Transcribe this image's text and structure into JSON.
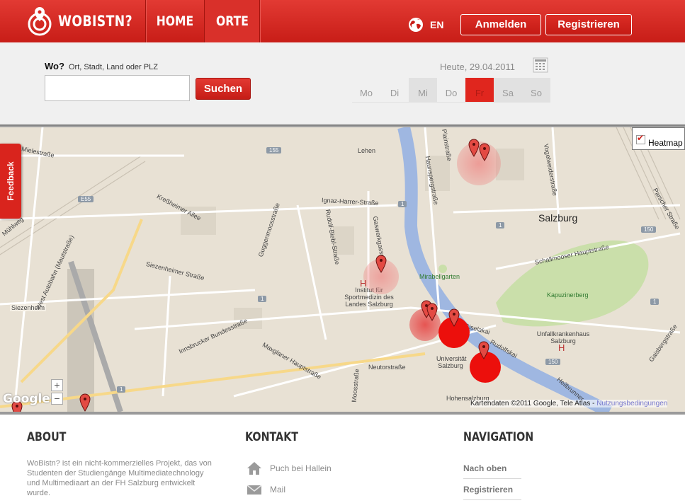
{
  "header": {
    "brand": "WOBISTN?",
    "nav": [
      {
        "label": "HOME"
      },
      {
        "label": "ORTE",
        "active": true
      }
    ],
    "language": "EN",
    "login_label": "Anmelden",
    "register_label": "Registrieren"
  },
  "search": {
    "wo_label": "Wo?",
    "hint": "Ort, Stadt, Land oder PLZ",
    "input_value": "",
    "button_label": "Suchen",
    "date_label": "Heute, 29.04.2011",
    "days": [
      "Mo",
      "Di",
      "Mi",
      "Do",
      "Fr",
      "Sa",
      "So"
    ],
    "selected_day": "Fr"
  },
  "map": {
    "heatmap_label": "Heatmap",
    "heatmap_checked": true,
    "zoom_in": "+",
    "zoom_out": "−",
    "provider": "Google",
    "credits": "Kartendaten ©2011 Google, Tele Atlas -",
    "terms_link": "Nutzungsbedingungen",
    "feedback_label": "Feedback",
    "labels": {
      "salzburg": "Salzburg",
      "lehen": "Lehen",
      "mirabellgarten": "Mirabellgarten",
      "kapuzinerberg": "Kapuzinerberg",
      "institut": "Institut für Sportmedizin des Landes Salzburg",
      "universitat": "Universität Salzburg",
      "unfallkrankenhaus": "Unfallkrankenhaus Salzburg",
      "hohensalzburg": "Hohensalzburg",
      "siezenheim": "Siezenheim",
      "ignaz": "Ignaz-Harrer-Straße",
      "kressheimer": "Kreßheimer Allee",
      "siezenheimer": "Siezenheimer Straße",
      "innsbrucker": "Innsbrucker Bundesstraße",
      "maxglaner": "Maxglaner Hauptstraße",
      "neutor": "Neutorstraße",
      "schallmooser": "Schallmooser Hauptstraße",
      "giselakai": "Giselakai",
      "rudolfskai": "Rudolfskai",
      "miele": "Mielestraße",
      "muhlweg": "Mühlweg",
      "westautobahn": "West Autobahn (Mautstraße)",
      "guggenmoos": "Guggenmoosstraße",
      "rudolf_biebl": "Rudolf-Biebl-Straße",
      "gaswerk": "Gaswerkgasse",
      "moos": "Moosstraße",
      "plainstr": "Plainstraße",
      "haunsperg": "Haunspergstraße",
      "vogelweider": "Vogelweiderstraße",
      "gaisberg": "Gaisbergstraße",
      "heilbrunner": "Heilbrunner",
      "parscher": "Parscher Straße"
    },
    "route_shields": {
      "r155": "155",
      "e55": "E55",
      "r150a": "150",
      "r150b": "150",
      "r1a": "1",
      "r1b": "1",
      "r1c": "1",
      "r1d": "1",
      "r1e": "1"
    }
  },
  "footer": {
    "about": {
      "title": "ABOUT",
      "text": "WoBistn? ist ein nicht-kommerzielles Projekt, das von Studenten der Studiengänge Multimediatechnology und Multimediaart an der FH Salzburg entwickelt wurde."
    },
    "contact": {
      "title": "KONTAKT",
      "address": "Puch bei Hallein",
      "mail": "Mail"
    },
    "navigation": {
      "title": "NAVIGATION",
      "links": [
        {
          "label": "Nach oben"
        },
        {
          "label": "Registrieren"
        }
      ]
    }
  },
  "colors": {
    "brand_red": "#d9241d",
    "band_gray": "#f0f0f0",
    "map_bg": "#e8e1d4",
    "river": "#9fb7e1",
    "park": "#cadfaa"
  }
}
